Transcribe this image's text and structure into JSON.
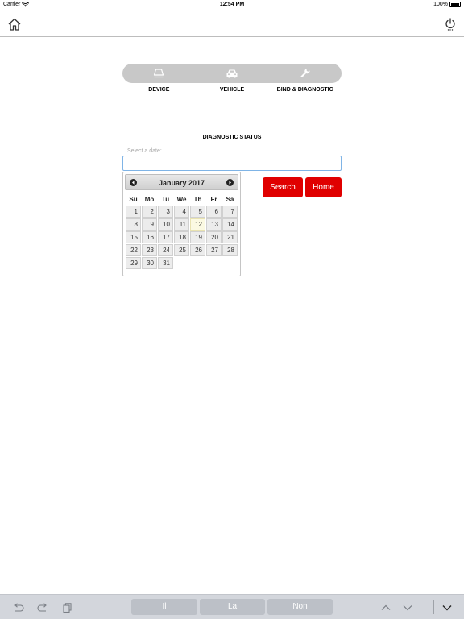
{
  "status_bar": {
    "carrier": "Carrier",
    "time": "12:54 PM",
    "battery": "100%"
  },
  "nav": {
    "home_icon": "home-icon",
    "power_icon": "power-icon"
  },
  "tabs": [
    {
      "label": "DEVICE",
      "icon": "device-icon"
    },
    {
      "label": "VEHICLE",
      "icon": "car-icon"
    },
    {
      "label": "BIND & DIAGNOSTIC",
      "icon": "wrench-icon"
    }
  ],
  "section_title": "DIAGNOSTIC STATUS",
  "date_field": {
    "label": "Select a date:",
    "value": ""
  },
  "buttons": {
    "search": "Search",
    "home": "Home"
  },
  "datepicker": {
    "month_year": "January 2017",
    "weekdays": [
      "Su",
      "Mo",
      "Tu",
      "We",
      "Th",
      "Fr",
      "Sa"
    ],
    "weeks": [
      [
        "1",
        "2",
        "3",
        "4",
        "5",
        "6",
        "7"
      ],
      [
        "8",
        "9",
        "10",
        "11",
        "12",
        "13",
        "14"
      ],
      [
        "15",
        "16",
        "17",
        "18",
        "19",
        "20",
        "21"
      ],
      [
        "22",
        "23",
        "24",
        "25",
        "26",
        "27",
        "28"
      ],
      [
        "29",
        "30",
        "31",
        "",
        "",
        "",
        ""
      ]
    ],
    "today": "12"
  },
  "keyboard_bar": {
    "suggestions": [
      "Il",
      "La",
      "Non"
    ]
  },
  "colors": {
    "accent_red": "#e00000",
    "tab_bg": "#c8c8c8",
    "input_border": "#7fb4e6"
  }
}
